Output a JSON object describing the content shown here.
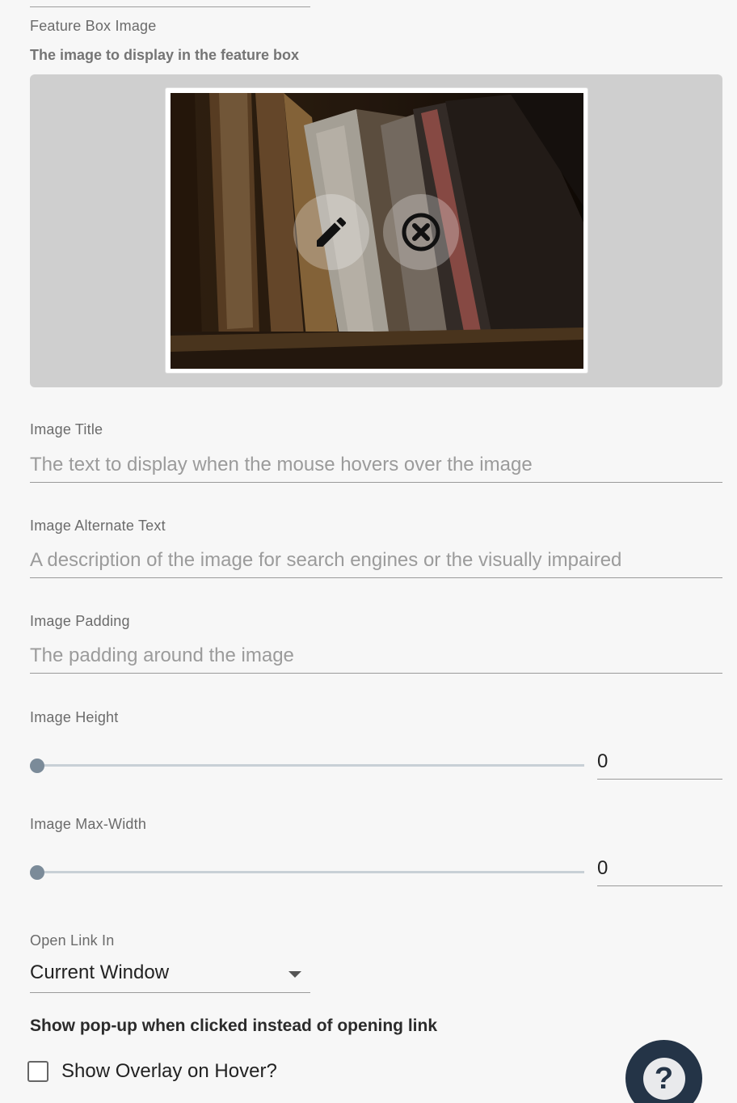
{
  "feature_box_image": {
    "label": "Feature Box Image",
    "description": "The image to display in the feature box",
    "actions": {
      "edit_icon": "pencil-icon",
      "remove_icon": "close-circle-icon"
    }
  },
  "image_title": {
    "label": "Image Title",
    "placeholder": "The text to display when the mouse hovers over the image",
    "value": ""
  },
  "image_alt": {
    "label": "Image Alternate Text",
    "placeholder": "A description of the image for search engines or the visually impaired",
    "value": ""
  },
  "image_padding": {
    "label": "Image Padding",
    "placeholder": "The padding around the image",
    "value": ""
  },
  "image_height": {
    "label": "Image Height",
    "value": "0",
    "slider_fraction": 0
  },
  "image_max_width": {
    "label": "Image Max-Width",
    "value": "0",
    "slider_fraction": 0
  },
  "open_link_in": {
    "label": "Open Link In",
    "selected": "Current Window"
  },
  "popup_heading": "Show pop-up when clicked instead of opening link",
  "overlay_checkbox": {
    "label": "Show Overlay on Hover?",
    "checked": false
  },
  "help_button": {
    "glyph": "?",
    "icon": "help-icon"
  },
  "colors": {
    "background": "#f7f7f7",
    "image_panel": "#cfcfcf",
    "slider_thumb": "#7b8b99",
    "help_fab": "#243447"
  }
}
